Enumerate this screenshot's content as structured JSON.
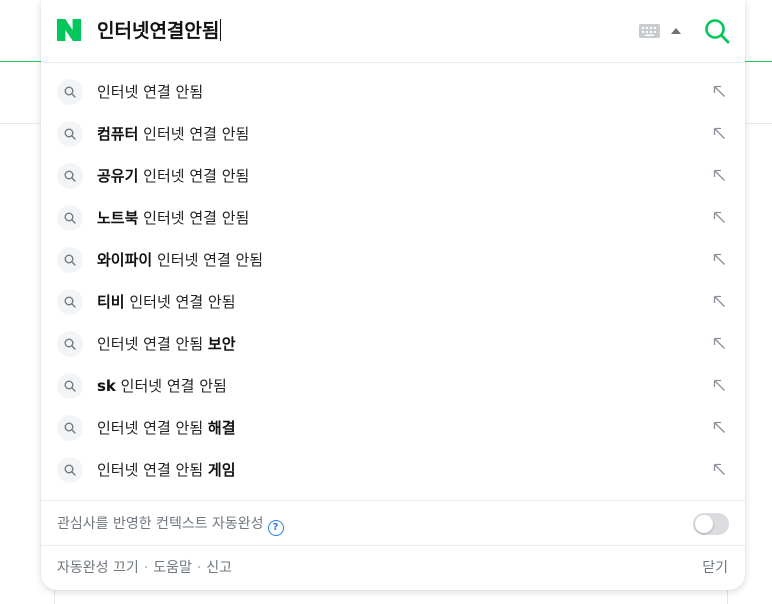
{
  "colors": {
    "brand_green": "#03c75a",
    "accent_blue": "#2b7de9",
    "muted_text": "#707780"
  },
  "search": {
    "query": "인터넷연결안됨",
    "keyboard_icon": "keyboard-icon",
    "collapse_icon": "arrow-up-icon",
    "submit_icon": "search-icon"
  },
  "suggestions": [
    {
      "pre": "",
      "bold": "",
      "post": "인터넷 연결 안됨",
      "tail": ""
    },
    {
      "pre": "",
      "bold": "컴퓨터",
      "post": " 인터넷 연결 안됨",
      "tail": ""
    },
    {
      "pre": "",
      "bold": "공유기",
      "post": " 인터넷 연결 안됨",
      "tail": ""
    },
    {
      "pre": "",
      "bold": "노트북",
      "post": " 인터넷 연결 안됨",
      "tail": ""
    },
    {
      "pre": "",
      "bold": "와이파이",
      "post": " 인터넷 연결 안됨",
      "tail": ""
    },
    {
      "pre": "",
      "bold": "티비",
      "post": " 인터넷 연결 안됨",
      "tail": ""
    },
    {
      "pre": "인터넷 연결 안됨 ",
      "bold": "",
      "post": "",
      "tail": "보안"
    },
    {
      "pre": "",
      "bold": "sk",
      "post": " 인터넷 연결 안됨",
      "tail": ""
    },
    {
      "pre": "인터넷 연결 안됨 ",
      "bold": "",
      "post": "",
      "tail": "해결"
    },
    {
      "pre": "인터넷 연결 안됨 ",
      "bold": "",
      "post": "",
      "tail": "게임"
    }
  ],
  "context": {
    "label": "관심사를 반영한 컨텍스트 자동완성",
    "help_glyph": "?",
    "toggle_on": false
  },
  "footer": {
    "links": [
      "자동완성 끄기",
      "도움말",
      "신고"
    ],
    "separator": "·",
    "close_label": "닫기"
  }
}
